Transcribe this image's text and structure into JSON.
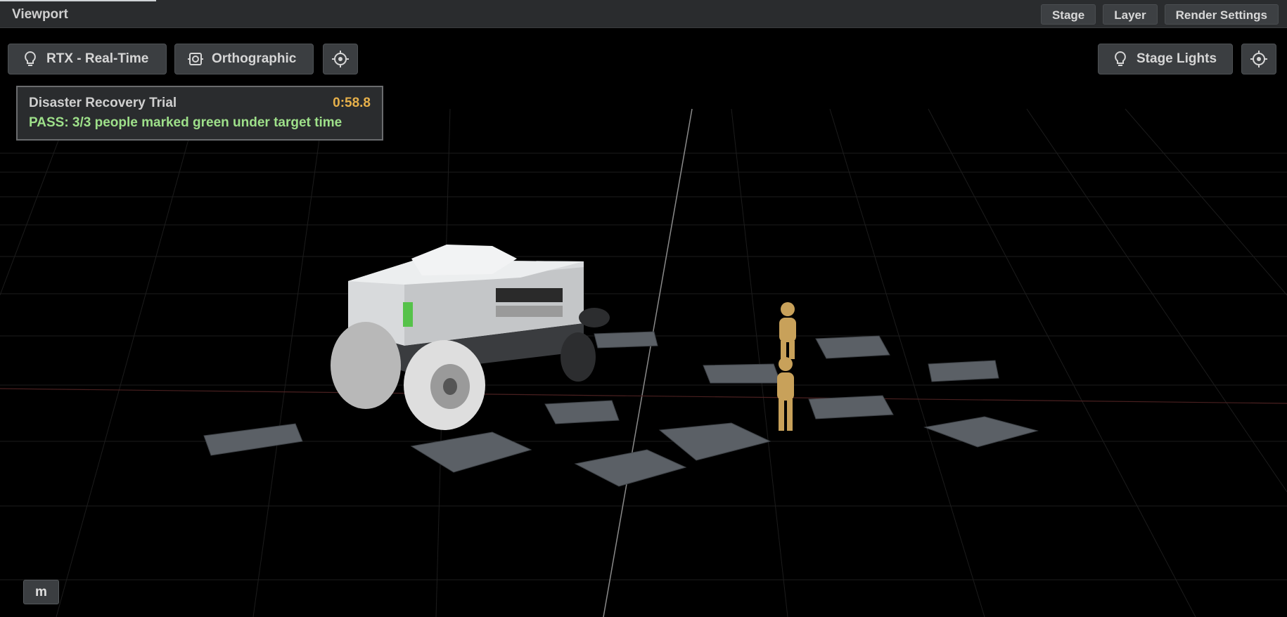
{
  "window": {
    "title": "Viewport"
  },
  "menus": {
    "stage": "Stage",
    "layer": "Layer",
    "render_settings": "Render Settings"
  },
  "toolbar": {
    "render_mode": "RTX - Real-Time",
    "projection": "Orthographic",
    "lights": "Stage Lights"
  },
  "hud": {
    "trial_name": "Disaster Recovery Trial",
    "timer": "0:58.8",
    "status": "PASS: 3/3 people marked green under target time"
  },
  "key_hint": "m",
  "icons": {
    "render_mode": "lightbulb-icon",
    "projection": "camera-frame-icon",
    "camera_target": "crosshair-icon",
    "lights": "lightbulb-icon",
    "lights_target": "crosshair-icon"
  },
  "colors": {
    "timer": "#e6b04a",
    "status": "#9ee08a",
    "figure": "#c8a15a"
  }
}
